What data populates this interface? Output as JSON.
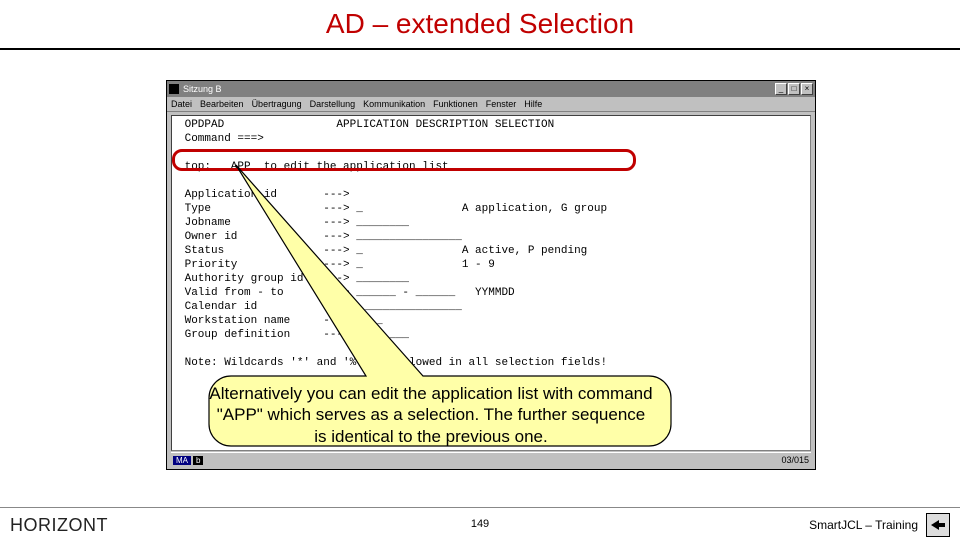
{
  "title": "AD – extended Selection",
  "terminal": {
    "window_title": "Sitzung B",
    "menu": [
      "Datei",
      "Bearbeiten",
      "Übertragung",
      "Darstellung",
      "Kommunikation",
      "Funktionen",
      "Fenster",
      "Hilfe"
    ],
    "lines": [
      " OPDPAD                 APPLICATION DESCRIPTION SELECTION",
      " Command ===>",
      "",
      " top:   APP  to edit the application list",
      "",
      " Application id       --->",
      " Type                 ---> _               A application, G group",
      " Jobname              ---> ________",
      " Owner id             ---> ________________",
      " Status               ---> _               A active, P pending",
      " Priority             ---> _               1 - 9",
      " Authority group id   ---> ________",
      " Valid from - to      ---> ______ - ______   YYMMDD",
      " Calendar id          ---> ________________",
      " Workstation name     ---> ____",
      " Group definition     ---> ________",
      "",
      " Note: Wildcards '*' and '%' are allowed in all selection fields!"
    ],
    "status_left_1": "MA",
    "status_left_2": "b",
    "status_right": "03/015"
  },
  "callout_text": "Alternatively you can edit the application list with command \"APP\" which serves as a selection. The further sequence is identical to the previous one.",
  "footer": {
    "left": "HORIZONT",
    "page": "149",
    "right": "SmartJCL – Training"
  }
}
